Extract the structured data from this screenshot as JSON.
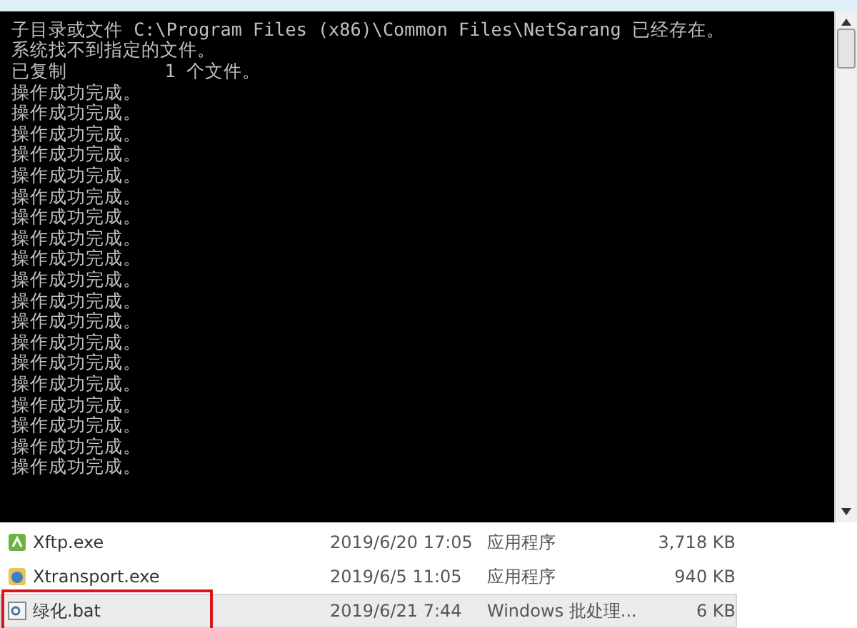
{
  "console": {
    "lines": [
      "子目录或文件 C:\\Program Files (x86)\\Common Files\\NetSarang 已经存在。",
      "系统找不到指定的文件。",
      "已复制         1 个文件。",
      "操作成功完成。",
      "操作成功完成。",
      "操作成功完成。",
      "操作成功完成。",
      "操作成功完成。",
      "操作成功完成。",
      "操作成功完成。",
      "操作成功完成。",
      "操作成功完成。",
      "操作成功完成。",
      "操作成功完成。",
      "操作成功完成。",
      "操作成功完成。",
      "操作成功完成。",
      "操作成功完成。",
      "操作成功完成。",
      "操作成功完成。",
      "操作成功完成。",
      "操作成功完成。"
    ]
  },
  "files": [
    {
      "kind": "app",
      "name": "Xftp.exe",
      "date": "2019/6/20 17:05",
      "type": "应用程序",
      "size": "3,718 KB",
      "selected": false,
      "marked": false
    },
    {
      "kind": "transport",
      "name": "Xtransport.exe",
      "date": "2019/6/5 11:05",
      "type": "应用程序",
      "size": "940 KB",
      "selected": false,
      "marked": false
    },
    {
      "kind": "batch",
      "name": "绿化.bat",
      "date": "2019/6/21 7:44",
      "type": "Windows 批处理...",
      "size": "6 KB",
      "selected": true,
      "marked": true
    }
  ]
}
